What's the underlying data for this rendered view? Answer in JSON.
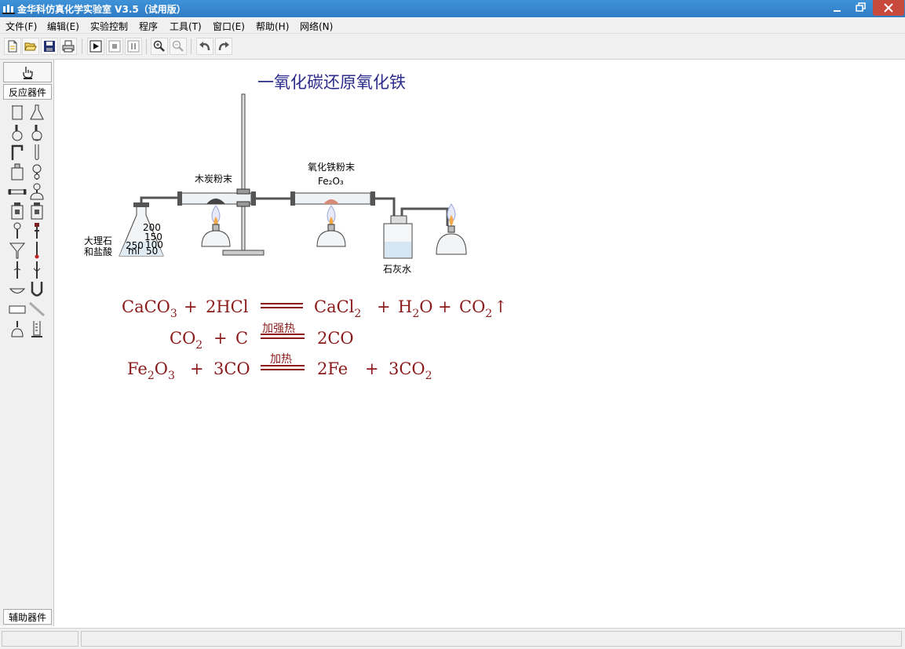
{
  "window": {
    "title": "金华科仿真化学实验室 V3.5（试用版）"
  },
  "menu": [
    "文件(F)",
    "编辑(E)",
    "实验控制",
    "程序",
    "工具(T)",
    "窗口(E)",
    "帮助(H)",
    "网络(N)"
  ],
  "panel": {
    "tab_reaction": "反应器件",
    "tab_auxiliary": "辅助器件"
  },
  "experiment": {
    "title": "一氧化碳还原氧化铁",
    "label_marble_1": "大理石",
    "label_marble_2": "和盐酸",
    "label_charcoal": "木炭粉末",
    "label_iron_oxide": "氧化铁粉末",
    "label_fe2o3": "Fe₂O₃",
    "label_limewater": "石灰水",
    "flask_marks": [
      "250",
      "ml",
      "200",
      "150",
      "100",
      "50"
    ]
  },
  "equations": {
    "eq1": {
      "left_1": "CaCO",
      "left_1_sub": "3",
      "plus_1": "+",
      "left_2": "2HCl",
      "right_1": "CaCl",
      "right_1_sub": "2",
      "plus_2": "+",
      "right_2": "H",
      "right_2_sub": "2",
      "right_2_tail": "O",
      "plus_3": "+",
      "right_3": "CO",
      "right_3_sub": "2",
      "arrow": "↑"
    },
    "eq2": {
      "left_1": "CO",
      "left_1_sub": "2",
      "plus_1": "+",
      "left_2": "C",
      "condition": "加强热",
      "right_1": "2CO"
    },
    "eq3": {
      "left_1": "Fe",
      "left_1_sub": "2",
      "left_1_mid": "O",
      "left_1_sub2": "3",
      "plus_1": "+",
      "left_2": "3CO",
      "condition": "加热",
      "right_1": "2Fe",
      "plus_2": "+",
      "right_2": "3CO",
      "right_2_sub": "2"
    }
  },
  "colors": {
    "title_blue": "#2c2c8c",
    "equation_red": "#8b1a1a",
    "titlebar": "#3a8ad4"
  }
}
